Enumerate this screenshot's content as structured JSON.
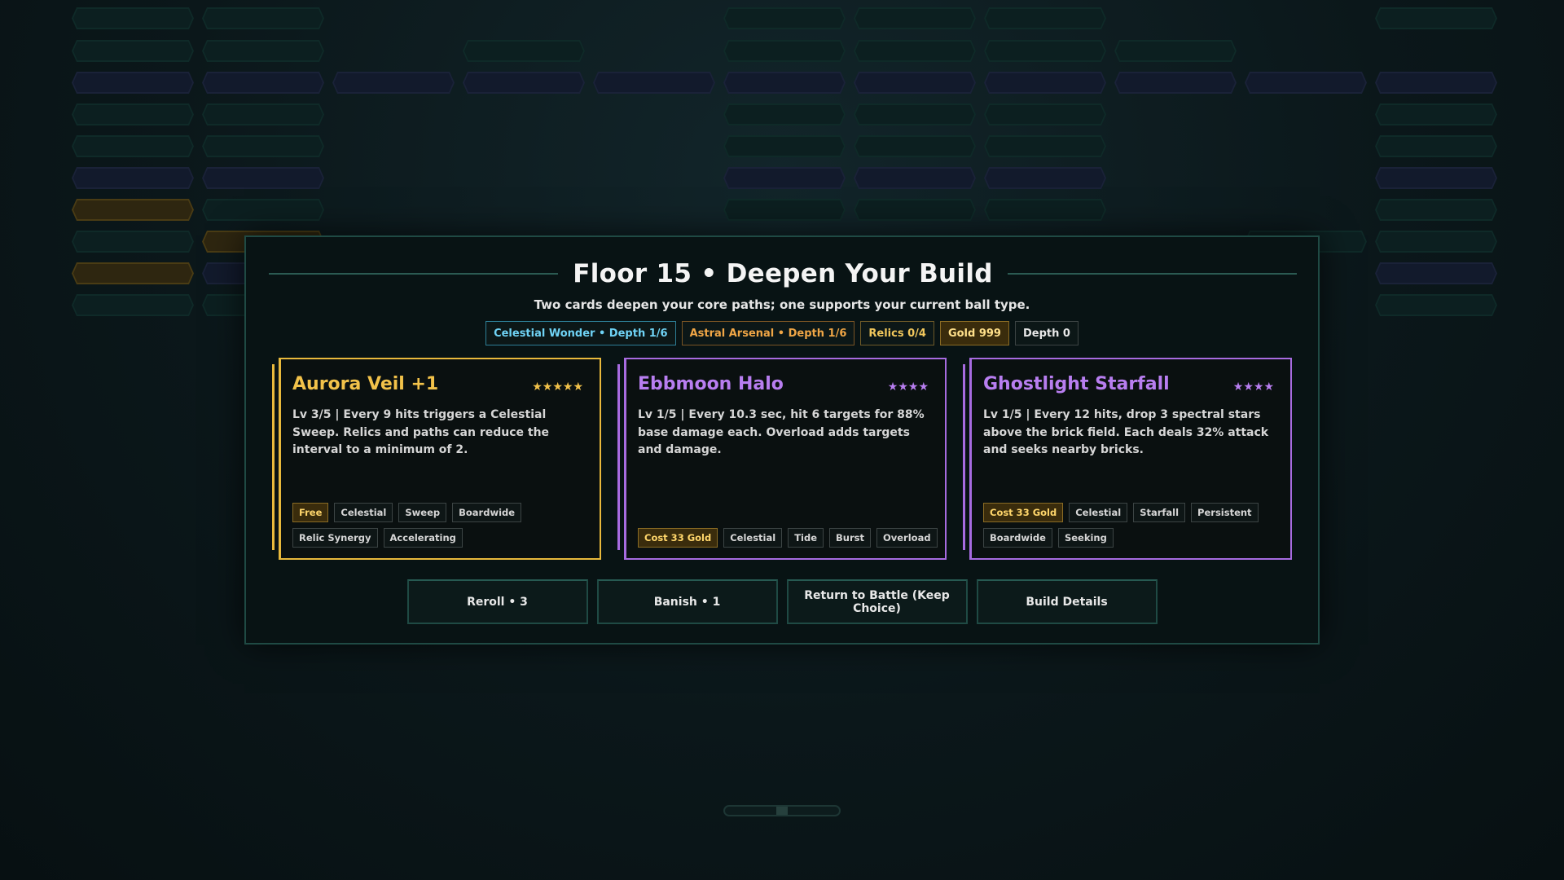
{
  "modal": {
    "title": "Floor 15 • Deepen Your Build",
    "subtitle": "Two cards deepen your core paths; one supports your current ball type.",
    "chips": [
      {
        "label": "Celestial Wonder • Depth 1/6",
        "color": "#6fd3f5"
      },
      {
        "label": "Astral Arsenal • Depth 1/6",
        "color": "#f0a646"
      },
      {
        "label": "Relics 0/4",
        "color": "#f1c75c"
      },
      {
        "label": "Gold 999",
        "color": "#ffe08a"
      },
      {
        "label": "Depth 0",
        "color": "#e8e8e8"
      }
    ],
    "cards": [
      {
        "name": "Aurora Veil +1",
        "stars": "★★★★★",
        "rarity_color": "#f2c24a",
        "description": "Lv 3/5 | Every 9 hits triggers a Celestial Sweep. Relics and paths can reduce the interval to a minimum of 2.",
        "tags": [
          "Free",
          "Celestial",
          "Sweep",
          "Boardwide",
          "Relic Synergy",
          "Accelerating"
        ]
      },
      {
        "name": "Ebbmoon Halo",
        "stars": "★★★★",
        "rarity_color": "#b87ef0",
        "description": "Lv 1/5 | Every 10.3 sec, hit 6 targets for 88% base damage each. Overload adds targets and damage.",
        "tags": [
          "Cost 33 Gold",
          "Celestial",
          "Tide",
          "Burst",
          "Overload"
        ]
      },
      {
        "name": "Ghostlight Starfall",
        "stars": "★★★★",
        "rarity_color": "#b87ef0",
        "description": "Lv 1/5 | Every 12 hits, drop 3 spectral stars above the brick field. Each deals 32% attack and seeks nearby bricks.",
        "tags": [
          "Cost 33 Gold",
          "Celestial",
          "Starfall",
          "Persistent",
          "Boardwide",
          "Seeking"
        ]
      }
    ],
    "actions": {
      "reroll": "Reroll • 3",
      "banish": "Banish • 1",
      "return": "Return to Battle (Keep Choice)",
      "details": "Build Details"
    }
  }
}
